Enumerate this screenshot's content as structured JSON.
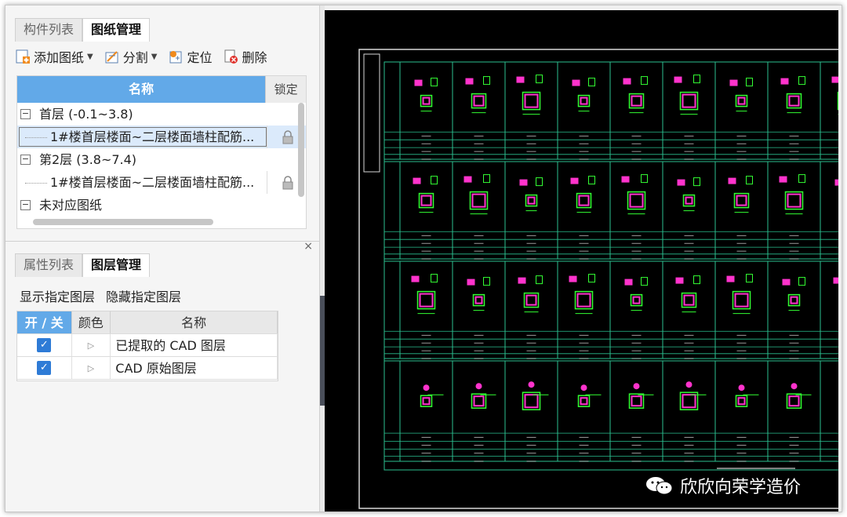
{
  "top_panel": {
    "tabs": [
      {
        "label": "构件列表",
        "active": false
      },
      {
        "label": "图纸管理",
        "active": true
      }
    ],
    "toolbar": {
      "add": "添加图纸",
      "split": "分割",
      "locate": "定位",
      "delete": "删除"
    },
    "table": {
      "col_name": "名称",
      "col_lock": "锁定",
      "rows": [
        {
          "label": "首层 (-0.1~3.8)",
          "type": "group",
          "expand": "−"
        },
        {
          "label": "1#楼首层楼面~二层楼面墙柱配筋...",
          "type": "child",
          "locked": true,
          "selected": true
        },
        {
          "label": "第2层 (3.8~7.4)",
          "type": "group",
          "expand": "−"
        },
        {
          "label": "1#楼首层楼面~二层楼面墙柱配筋...",
          "type": "child",
          "locked": true,
          "selected": false
        },
        {
          "label": "未对应图纸",
          "type": "group",
          "expand": "−"
        }
      ]
    }
  },
  "bottom_panel": {
    "close": "×",
    "tabs": [
      {
        "label": "属性列表",
        "active": false
      },
      {
        "label": "图层管理",
        "active": true
      }
    ],
    "links": {
      "show": "显示指定图层",
      "hide": "隐藏指定图层"
    },
    "table": {
      "col_toggle": "开 / 关",
      "col_color": "颜色",
      "col_name": "名称",
      "rows": [
        {
          "checked": true,
          "color_marker": "▷",
          "name": "已提取的 CAD 图层"
        },
        {
          "checked": true,
          "color_marker": "▷",
          "name": "CAD 原始图层"
        }
      ]
    }
  },
  "cad_view": {
    "background": "#000000",
    "colors": {
      "frame": "#d8d8d8",
      "grid": "#2bbf8f",
      "rebar": "#ff33cc",
      "outline": "#33ff33",
      "text": "#ffffff"
    }
  },
  "watermark": {
    "text": "欣欣向荣学造价",
    "icon": "wechat-icon"
  }
}
